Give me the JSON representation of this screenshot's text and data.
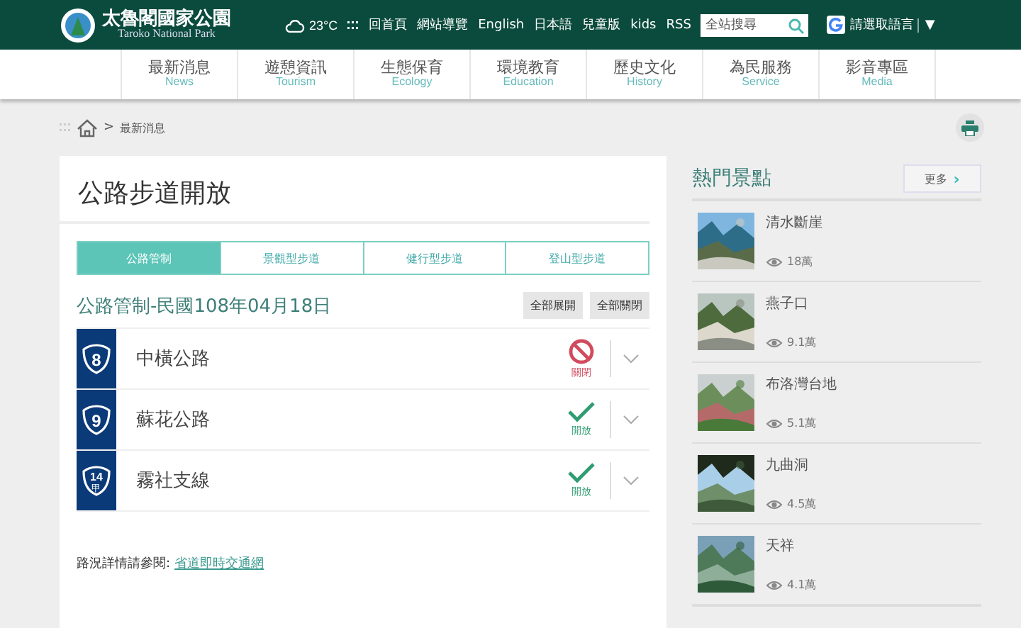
{
  "header": {
    "logo": "太魯閣國家公園",
    "logo_subtitle": "Taroko National Park",
    "weather": "23°C",
    "links": [
      "回首頁",
      "網站導覽",
      "English",
      "日本語",
      "兒童版",
      "kids",
      "RSS"
    ],
    "search": {
      "placeholder": "全站搜尋"
    },
    "translate": "請選取語言",
    "translate_caret": "▼"
  },
  "nav": [
    {
      "label": "最新消息",
      "sub": "News"
    },
    {
      "label": "遊憩資訊",
      "sub": "Tourism"
    },
    {
      "label": "生態保育",
      "sub": "Ecology"
    },
    {
      "label": "環境教育",
      "sub": "Education"
    },
    {
      "label": "歷史文化",
      "sub": "History"
    },
    {
      "label": "為民服務",
      "sub": "Service"
    },
    {
      "label": "影音專區",
      "sub": "Media"
    }
  ],
  "breadcrumb": {
    "separator": ">",
    "current": "最新消息"
  },
  "main": {
    "title": "公路步道開放",
    "tabs": [
      {
        "label": "公路管制",
        "selected": true
      },
      {
        "label": "景觀型步道",
        "selected": false
      },
      {
        "label": "健行型步道",
        "selected": false
      },
      {
        "label": "登山型步道",
        "selected": false
      }
    ],
    "heading": "公路管制-民國108年04月18日",
    "buttons": [
      "全部展開",
      "全部關閉"
    ],
    "roads": [
      {
        "number": "8",
        "name": "中橫公路",
        "kind": "closed",
        "status_label": "關閉",
        "expanded": false
      },
      {
        "number": "9",
        "name": "蘇花公路",
        "kind": "open",
        "status_label": "開放",
        "expanded": false
      },
      {
        "number": "14",
        "suffix": "甲",
        "name": "霧社支線",
        "kind": "open",
        "status_label": "開放",
        "expanded": false
      }
    ],
    "note": "路況詳情請參閱:",
    "note_link": "省道即時交通網"
  },
  "sidebar": {
    "title": "熱門景點",
    "more": "更多",
    "more_caret": "›",
    "items": [
      {
        "name": "清水斷崖",
        "views": "18萬"
      },
      {
        "name": "燕子口",
        "views": "9.1萬"
      },
      {
        "name": "布洛灣台地",
        "views": "5.1萬"
      },
      {
        "name": "九曲洞",
        "views": "4.5萬"
      },
      {
        "name": "天祥",
        "views": "4.1萬"
      }
    ]
  }
}
